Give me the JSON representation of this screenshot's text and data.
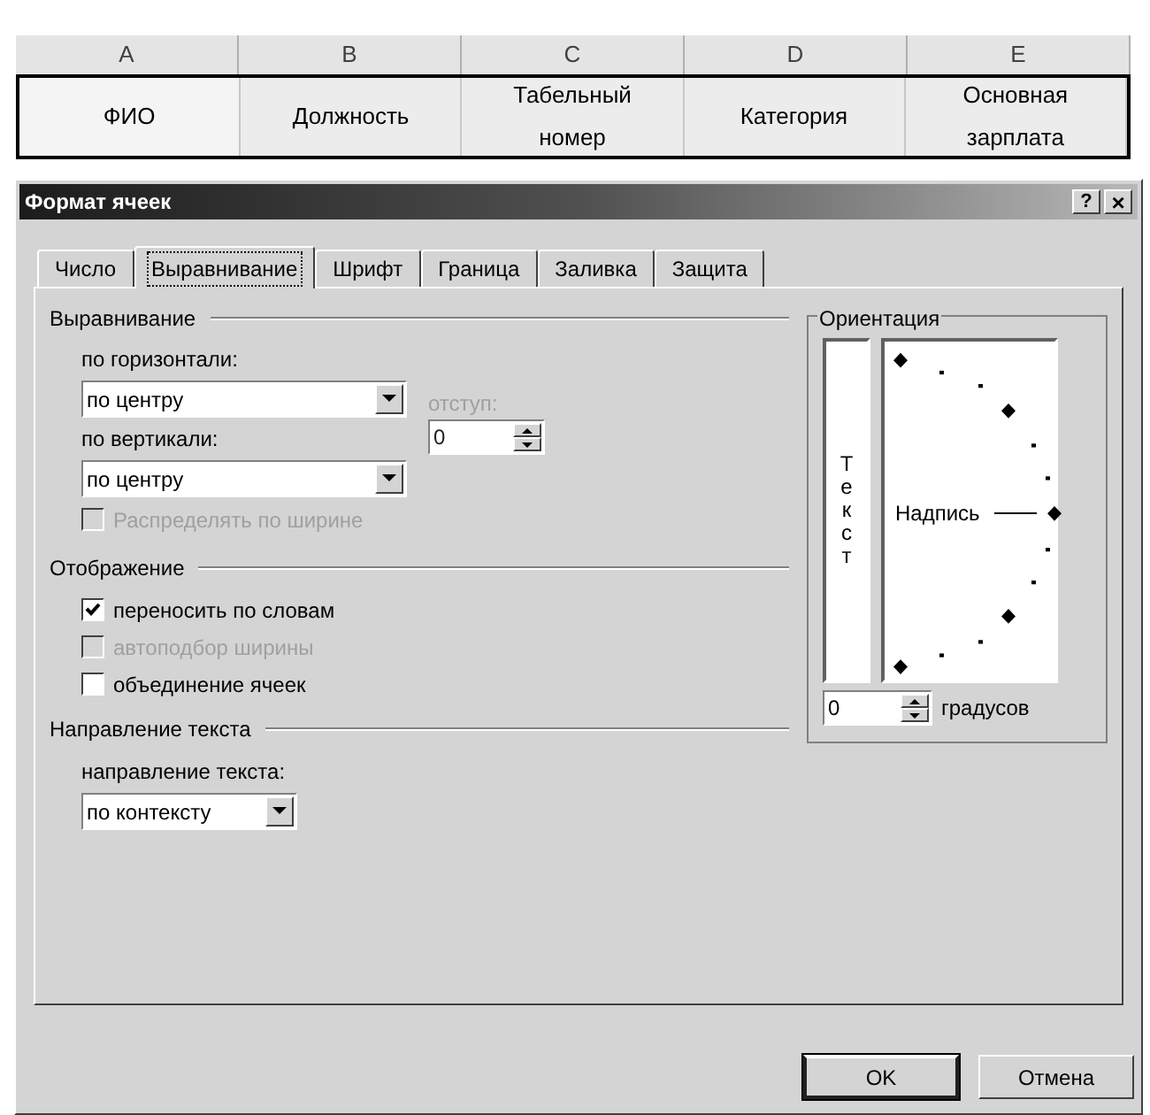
{
  "spreadsheet": {
    "columns": [
      "A",
      "B",
      "C",
      "D",
      "E"
    ],
    "row": [
      "ФИО",
      "Должность",
      "Табельный номер",
      "Категория",
      "Основная зарплата"
    ]
  },
  "dialog": {
    "title": "Формат ячеек",
    "help": "?",
    "close": "×",
    "tabs": [
      {
        "label": "Число",
        "selected": false
      },
      {
        "label": "Выравнивание",
        "selected": true
      },
      {
        "label": "Шрифт",
        "selected": false
      },
      {
        "label": "Граница",
        "selected": false
      },
      {
        "label": "Заливка",
        "selected": false
      },
      {
        "label": "Защита",
        "selected": false
      }
    ],
    "alignment": {
      "legend": "Выравнивание",
      "horizontal": {
        "label": "по горизонтали:",
        "value": "по центру"
      },
      "indent": {
        "label": "отступ:",
        "value": "0",
        "disabled": true
      },
      "vertical": {
        "label": "по вертикали:",
        "value": "по центру"
      },
      "distribute": {
        "label": "Распределять по ширине",
        "checked": false,
        "disabled": true
      }
    },
    "display": {
      "legend": "Отображение",
      "options": [
        {
          "label": "переносить по словам",
          "checked": true,
          "disabled": false
        },
        {
          "label": "автоподбор ширины",
          "checked": false,
          "disabled": true
        },
        {
          "label": "объединение ячеек",
          "checked": false,
          "disabled": false
        }
      ]
    },
    "direction": {
      "legend": "Направление текста",
      "label": "направление текста:",
      "value": "по контексту"
    },
    "orientation": {
      "legend": "Ориентация",
      "vertical_text": "Текст",
      "dial_label": "Надпись",
      "degrees": "0",
      "unit": "градусов"
    },
    "buttons": [
      {
        "label": "OK",
        "default": true
      },
      {
        "label": "Отмена",
        "default": false
      }
    ]
  }
}
